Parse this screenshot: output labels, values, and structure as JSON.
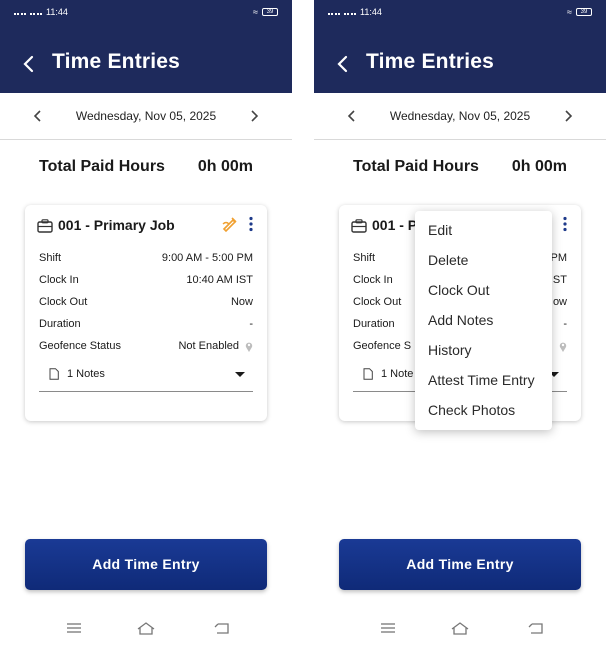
{
  "status_bar": {
    "time": "11:44",
    "battery": "39"
  },
  "header": {
    "title": "Time Entries"
  },
  "date_bar": {
    "date": "Wednesday, Nov 05, 2025"
  },
  "summary": {
    "total_label": "Total Paid Hours",
    "total_value": "0h 00m"
  },
  "card": {
    "job_title": "001 - Primary Job",
    "job_title_truncated": "001 - P",
    "rows": [
      {
        "label": "Shift",
        "value": "9:00 AM - 5:00 PM",
        "value_visible": "PM"
      },
      {
        "label": "Clock In",
        "value": "10:40 AM IST",
        "value_visible": "IST"
      },
      {
        "label": "Clock Out",
        "value": "Now",
        "value_visible": "ow"
      },
      {
        "label": "Duration",
        "value": "-",
        "value_visible": "-"
      },
      {
        "label": "Geofence Status",
        "label_visible": "Geofence S",
        "value": "Not Enabled",
        "value_visible": ""
      }
    ],
    "notes_label": "1 Notes",
    "notes_label_truncated": "1 Note"
  },
  "context_menu": {
    "items": [
      "Edit",
      "Delete",
      "Clock Out",
      "Add Notes",
      "History",
      "Attest Time Entry",
      "Check Photos"
    ]
  },
  "actions": {
    "add_time_entry": "Add Time Entry"
  },
  "icons": {
    "back": "chevron-left-icon",
    "prev_date": "chevron-left-icon",
    "next_date": "chevron-right-icon",
    "job": "briefcase-icon",
    "attest": "attest-pen-icon",
    "more": "kebab-menu-icon",
    "location": "location-pin-icon",
    "notes": "document-icon",
    "nav_menu": "hamburger-icon",
    "nav_home": "home-icon",
    "nav_back": "back-arrow-icon"
  },
  "colors": {
    "header": "#1e2a5c",
    "button": "#153488",
    "attest_icon": "#f0a030",
    "kebab": "#1e3a8a"
  }
}
